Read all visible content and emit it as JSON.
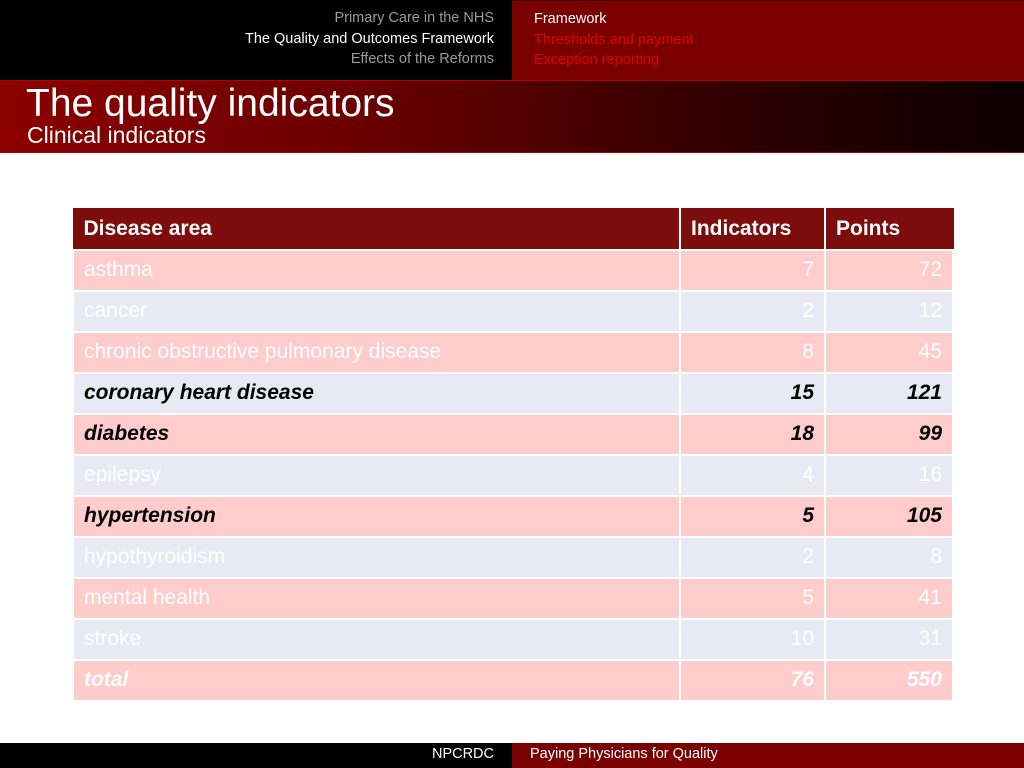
{
  "nav": {
    "sections": [
      {
        "label": "Primary Care in the NHS",
        "active": false
      },
      {
        "label": "The Quality and Outcomes Framework",
        "active": true
      },
      {
        "label": "Effects of the Reforms",
        "active": false
      }
    ],
    "topics": [
      {
        "label": "Framework",
        "active": true
      },
      {
        "label": "Thresholds and payment",
        "active": false
      },
      {
        "label": "Exception reporting",
        "active": false
      }
    ]
  },
  "slide": {
    "title": "The quality indicators",
    "subtitle": "Clinical indicators"
  },
  "table": {
    "headers": [
      "Disease area",
      "Indicators",
      "Points"
    ],
    "rows": [
      {
        "area": "asthma",
        "indicators": "7",
        "points": "72",
        "emphasis": "dim"
      },
      {
        "area": "cancer",
        "indicators": "2",
        "points": "12",
        "emphasis": "dim"
      },
      {
        "area": "chronic obstructive pulmonary disease",
        "indicators": "8",
        "points": "45",
        "emphasis": "dim"
      },
      {
        "area": "coronary heart disease",
        "indicators": "15",
        "points": "121",
        "emphasis": "highlight"
      },
      {
        "area": "diabetes",
        "indicators": "18",
        "points": "99",
        "emphasis": "highlight"
      },
      {
        "area": "epilepsy",
        "indicators": "4",
        "points": "16",
        "emphasis": "dim"
      },
      {
        "area": "hypertension",
        "indicators": "5",
        "points": "105",
        "emphasis": "highlight"
      },
      {
        "area": "hypothyroidism",
        "indicators": "2",
        "points": "8",
        "emphasis": "dim"
      },
      {
        "area": "mental health",
        "indicators": "5",
        "points": "41",
        "emphasis": "dim"
      },
      {
        "area": "stroke",
        "indicators": "10",
        "points": "31",
        "emphasis": "dim"
      },
      {
        "area": "total",
        "indicators": "76",
        "points": "550",
        "emphasis": "total"
      }
    ]
  },
  "footer": {
    "organisation": "NPCRDC",
    "presentation": "Paying Physicians for Quality"
  },
  "colors": {
    "brand_dark_red": "#7a0000",
    "header_red": "#7d0d0d",
    "row_pink": "#ffcccc",
    "row_blue": "#e7eaf3",
    "nav_inactive_red": "#e00000"
  }
}
